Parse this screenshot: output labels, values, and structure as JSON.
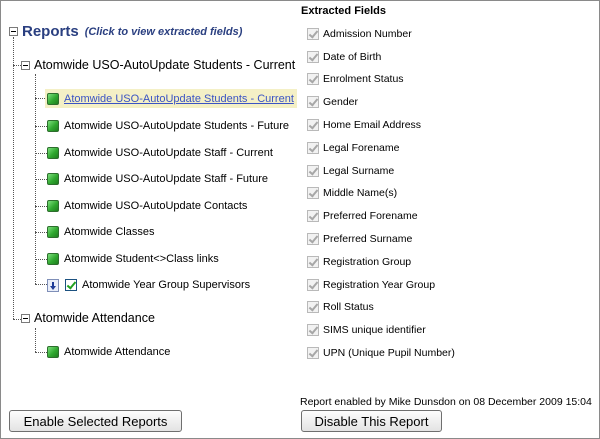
{
  "tree": {
    "root_label": "Reports",
    "root_hint": "(Click to view extracted fields)",
    "groups": [
      {
        "label": "Atomwide USO-AutoUpdate Students - Current",
        "items": [
          {
            "label": "Atomwide USO-AutoUpdate Students - Current",
            "selected": true
          },
          {
            "label": "Atomwide USO-AutoUpdate Students - Future"
          },
          {
            "label": "Atomwide USO-AutoUpdate Staff - Current"
          },
          {
            "label": "Atomwide USO-AutoUpdate Staff - Future"
          },
          {
            "label": "Atomwide USO-AutoUpdate Contacts"
          },
          {
            "label": "Atomwide Classes"
          },
          {
            "label": "Atomwide Student<>Class links"
          },
          {
            "label": "Atomwide Year Group Supervisors",
            "checkbox": true,
            "checked": true
          }
        ]
      },
      {
        "label": "Atomwide Attendance",
        "items": [
          {
            "label": "Atomwide Attendance"
          }
        ]
      }
    ]
  },
  "fields": {
    "header": "Extracted Fields",
    "items": [
      "Admission Number",
      "Date of Birth",
      "Enrolment Status",
      "Gender",
      "Home Email Address",
      "Legal Forename",
      "Legal Surname",
      "Middle Name(s)",
      "Preferred Forename",
      "Preferred Surname",
      "Registration Group",
      "Registration Year Group",
      "Roll Status",
      "SIMS unique identifier",
      "UPN (Unique Pupil Number)"
    ]
  },
  "status_text": "Report enabled by Mike Dunsdon on 08 December 2009 15:04",
  "buttons": {
    "enable_label": "Enable Selected Reports",
    "disable_label": "Disable This Report"
  },
  "colors": {
    "title": "#2a3f80",
    "selected_bg": "#f4f0c6",
    "link": "#3a53c4"
  }
}
